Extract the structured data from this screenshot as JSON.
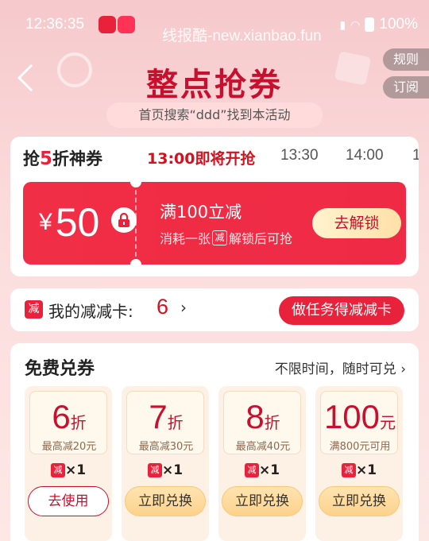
{
  "status_bar": {
    "time": "12:36:35",
    "watermark": "线报酷-new.xianbao.fun",
    "battery": "100%"
  },
  "header": {
    "title": "整点抢券",
    "rules_label": "规则",
    "subscribe_label": "订阅",
    "search_hint": "首页搜索“ddd”找到本活动"
  },
  "tabs": {
    "brand_prefix": "抢",
    "brand_num": "5",
    "brand_suffix": "折神券",
    "active_label": "13:00即将开抢",
    "times": [
      "13:30",
      "14:00",
      "1"
    ]
  },
  "featured_coupon": {
    "currency": "¥",
    "amount": "50",
    "condition": "满100立减",
    "desc_prefix": "消耗一张",
    "desc_badge": "减",
    "desc_suffix": "解锁后可抢",
    "button_label": "去解锁"
  },
  "card_row": {
    "badge": "减",
    "label": "我的减减卡:",
    "count": "6",
    "chevron": "›",
    "task_button": "做任务得减减卡"
  },
  "free_section": {
    "title": "免费兑券",
    "note": "不限时间，随时可兑 ›",
    "vouchers": [
      {
        "value": "6",
        "unit": "折",
        "sub": "最高减20元",
        "badge": "减",
        "qty": "×1",
        "button": "去使用"
      },
      {
        "value": "7",
        "unit": "折",
        "sub": "最高减30元",
        "badge": "减",
        "qty": "×1",
        "button": "立即兑换"
      },
      {
        "value": "8",
        "unit": "折",
        "sub": "最高减40元",
        "badge": "减",
        "qty": "×1",
        "button": "立即兑换"
      },
      {
        "value": "100",
        "unit": "元",
        "sub": "满800元可用",
        "badge": "减",
        "qty": "×1",
        "button": "立即兑换"
      }
    ]
  },
  "colors": {
    "accent": "#e8223a",
    "title_red": "#c8102e",
    "gold_button": "#fcd28c"
  }
}
